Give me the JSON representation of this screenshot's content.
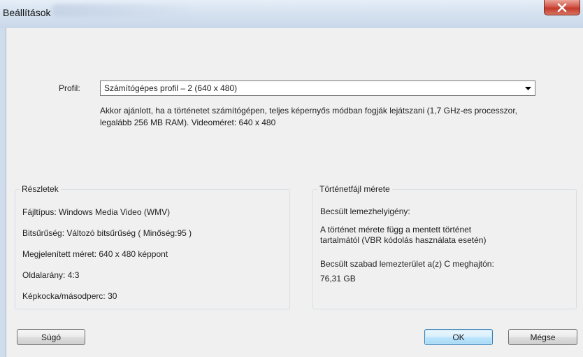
{
  "window": {
    "title": "Beállítások"
  },
  "profile": {
    "label": "Profil:",
    "selected": "Számítógépes profil – 2 (640 x 480)",
    "description": "Akkor ajánlott, ha a történetet számítógépen, teljes képernyős módban fogják lejátszani (1,7 GHz-es processzor, legalább 256 MB RAM). Videoméret: 640 x 480"
  },
  "details": {
    "title": "Részletek",
    "rows": [
      "Fájltípus:  Windows Media Video (WMV)",
      "Bitsűrűség:  Változó bitsűrűség ( Minőség:95 )",
      "Megjelenített méret:  640 x 480 képpont",
      "Oldalarány:  4:3",
      "Képkocka/másodperc:    30"
    ]
  },
  "filesize": {
    "title": "Történetfájl mérete",
    "estimate_label": "Becsült lemezhelyigény:",
    "estimate_note_line1": "A történet mérete függ a mentett történet",
    "estimate_note_line2": "tartalmától (VBR kódolás használata esetén)",
    "free_label": "Becsült szabad lemezterület a(z) C meghajtón:",
    "free_value": "76,31 GB"
  },
  "buttons": {
    "help": "Súgó",
    "ok": "OK",
    "cancel": "Mégse"
  },
  "icons": {
    "close": "close-icon",
    "dropdown": "chevron-down-icon"
  }
}
